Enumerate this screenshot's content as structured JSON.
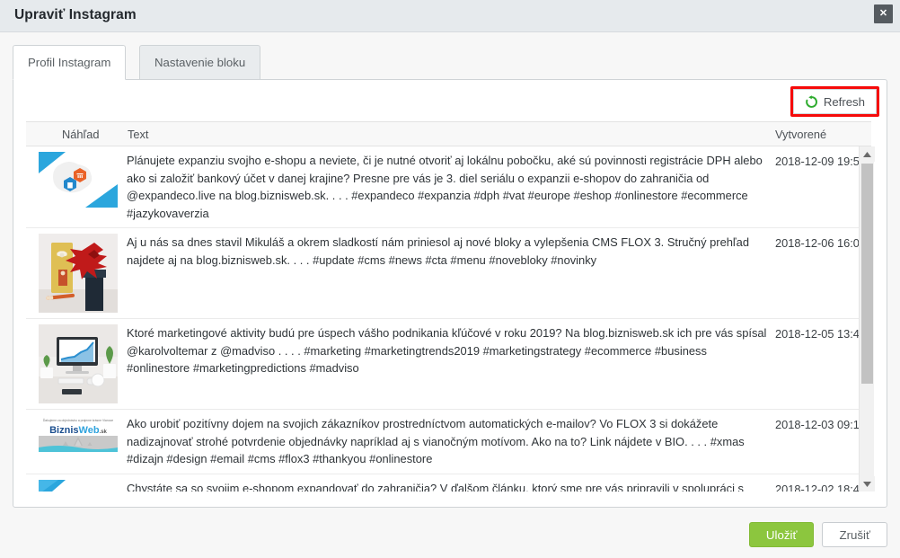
{
  "modal": {
    "title": "Upraviť Instagram",
    "close_label": "✕",
    "close_icon": "close-icon"
  },
  "tabs": [
    {
      "label": "Profil Instagram",
      "active": true
    },
    {
      "label": "Nastavenie bloku",
      "active": false
    }
  ],
  "toolbar": {
    "refresh_label": "Refresh",
    "refresh_icon": "refresh-rotate-icon",
    "highlight_color": "#f60a0a",
    "icon_color": "#2eab2e"
  },
  "table": {
    "columns": [
      "Náhľad",
      "Text",
      "Vytvorené"
    ],
    "rows": [
      {
        "thumb": "europe-map-hexagons-thumbnail",
        "text": "Plánujete expanziu svojho e-shopu a neviete, či je nutné otvoriť aj lokálnu pobočku, aké sú povinnosti registrácie DPH alebo ako si založiť bankový účet v danej krajine? Presne pre vás je 3. diel seriálu o expanzii e-shopov do zahraničia od @expandeco.live na blog.biznisweb.sk. . . . #expandeco #expanzia #dph #vat #europe #eshop #onlinestore #ecommerce #jazykovaverzia",
        "created": "2018-12-09 19:5"
      },
      {
        "thumb": "christmas-gift-poinsettia-thumbnail",
        "text": "Aj u nás sa dnes stavil Mikuláš a okrem sladkostí nám priniesol aj nové bloky a vylepšenia CMS FLOX 3. Stručný prehľad najdete aj na blog.biznisweb.sk. . . . #update #cms #news #cta #menu #novebloky #novinky",
        "created": "2018-12-06 16:0"
      },
      {
        "thumb": "imac-desk-analytics-thumbnail",
        "text": "Ktoré marketingové aktivity budú pre úspech vášho podnikania kľúčové v roku 2019? Na blog.biznisweb.sk ich pre vás spísal @karolvoltemar z @madviso . . . . #marketing #marketingtrends2019 #marketingstrategy #ecommerce #business #onlinestore #marketingpredictions #madviso",
        "created": "2018-12-05 13:4"
      },
      {
        "thumb": "biznisweb-email-banner-thumbnail",
        "text": "Ako urobiť pozitívny dojem na svojich zákazníkov prostredníctvom automatických e-mailov? Vo FLOX 3 si dokážete nadizajnovať strohé potvrdenie objednávky napríklad aj s vianočným motívom. Ako na to? Link nájdete v BIO. . . . #xmas #dizajn #design #email #cms #flox3 #thankyou #onlinestore",
        "created": "2018-12-03 09:1"
      },
      {
        "thumb": "blue-hexagons-expansion-thumbnail",
        "text": "Chystáte sa so svojim e-shopom expandovať do zahraničia? V ďalšom článku, ktorý sme pre vás pripravili v spolupráci s lídrom na trhu pre expanziu e-shopov do zahraničia @expandeco.live , sa dozviete, aké trhy sú pre vás najlepšou",
        "created": "2018-12-02 18:4"
      }
    ]
  },
  "scrollbar": {
    "up_icon": "scroll-up-arrow-icon",
    "down_icon": "scroll-down-arrow-icon"
  },
  "footer": {
    "save_label": "Uložiť",
    "cancel_label": "Zrušiť",
    "save_color": "#8cc63e"
  }
}
